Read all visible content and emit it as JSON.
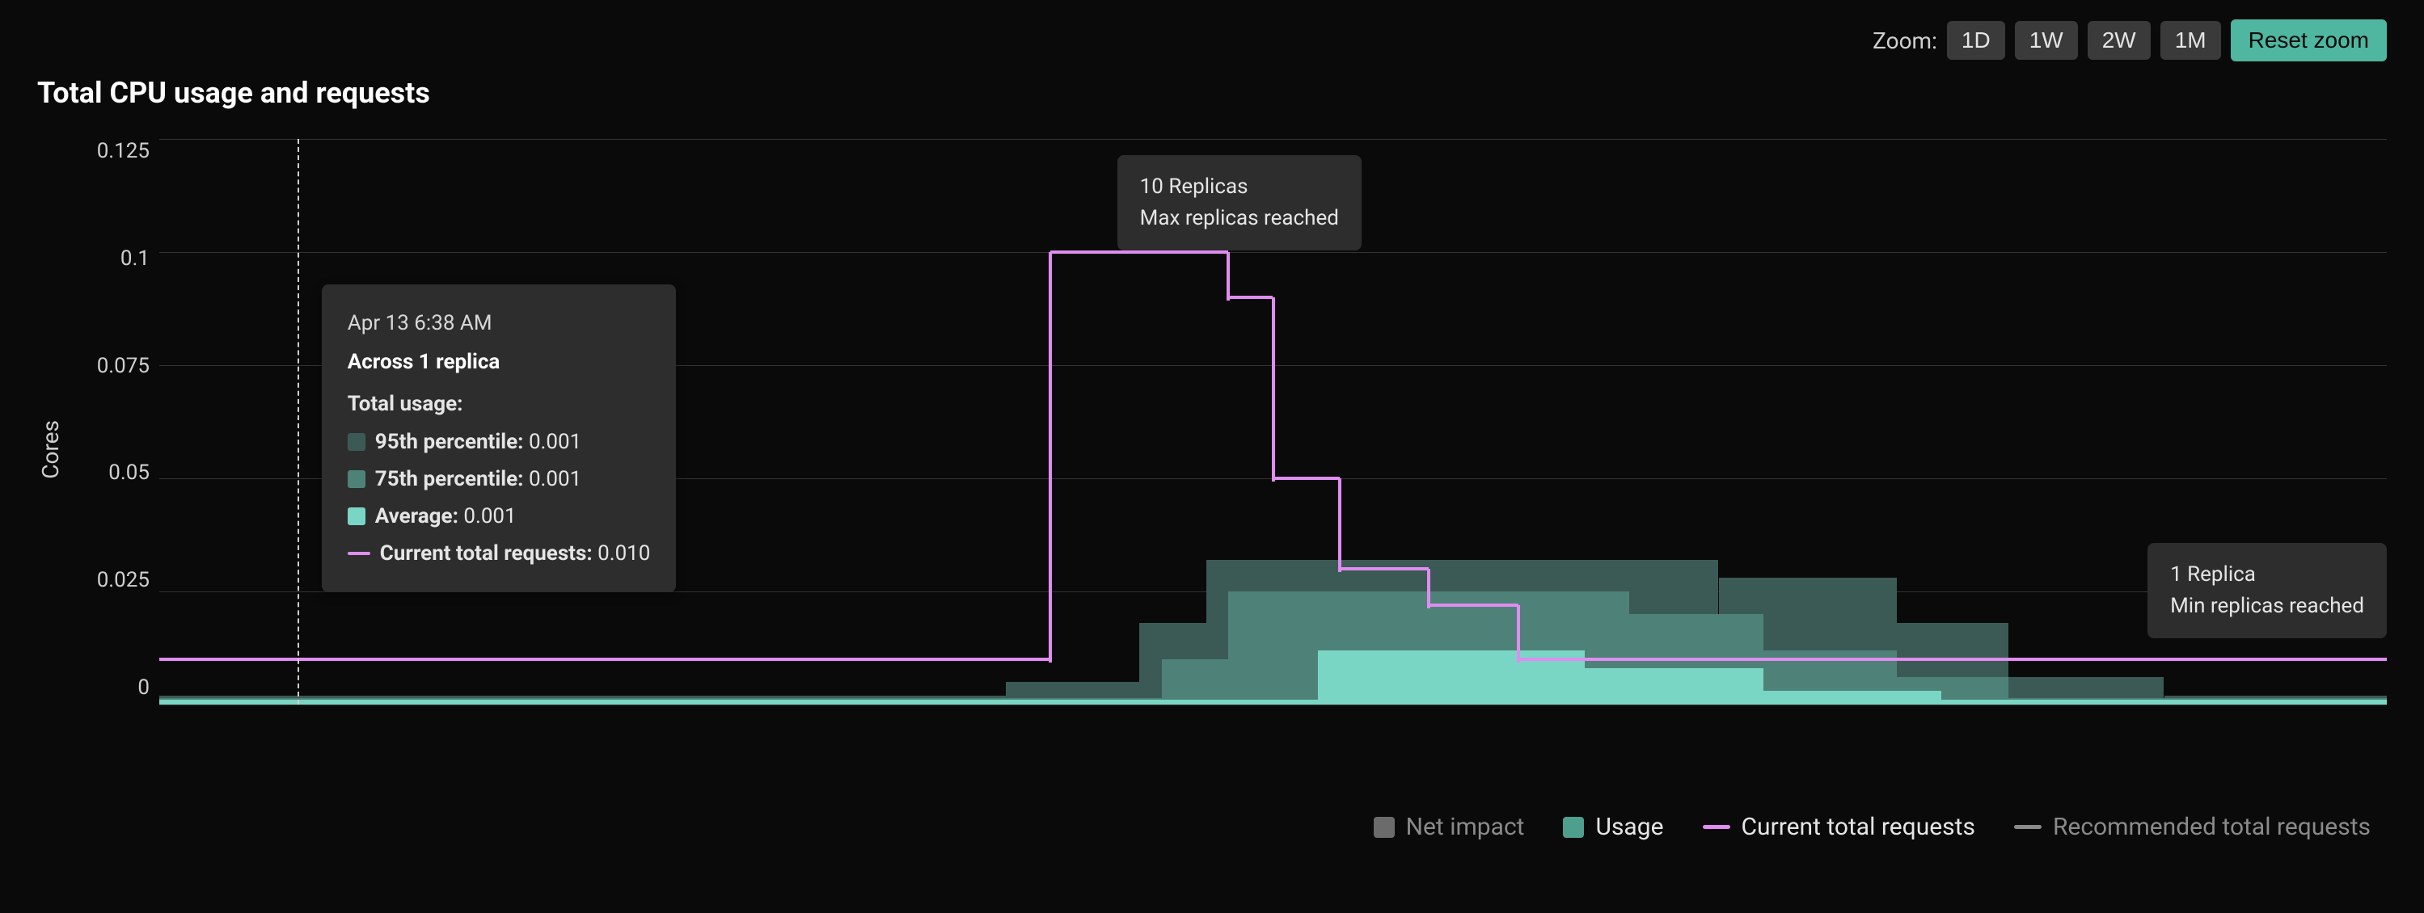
{
  "zoom": {
    "label": "Zoom:",
    "options": [
      "1D",
      "1W",
      "2W",
      "1M"
    ],
    "reset": "Reset zoom"
  },
  "title": "Total CPU usage and requests",
  "ylabel": "Cores",
  "tooltip": {
    "time": "Apr 13 6:38 AM",
    "replicas": "Across 1 replica",
    "section": "Total usage:",
    "p95_label": "95th percentile:",
    "p95_value": "0.001",
    "p75_label": "75th percentile:",
    "p75_value": "0.001",
    "avg_label": "Average:",
    "avg_value": "0.001",
    "req_label": "Current total requests:",
    "req_value": "0.010"
  },
  "callout_max": {
    "line1": "10 Replicas",
    "line2": "Max replicas reached"
  },
  "callout_min": {
    "line1": "1 Replica",
    "line2": "Min replicas reached"
  },
  "legend": {
    "net": "Net impact",
    "usage": "Usage",
    "current": "Current total requests",
    "recommended": "Recommended total requests"
  },
  "chart_data": {
    "type": "area+line",
    "ylabel": "Cores",
    "ylim": [
      0,
      0.125
    ],
    "yticks": [
      0,
      0.025,
      0.05,
      0.075,
      0.1,
      0.125
    ],
    "x_range_pct": [
      0,
      100
    ],
    "cursor_x_pct": 6.2,
    "series": [
      {
        "name": "95th percentile",
        "kind": "area",
        "color": "#3c5a55",
        "segments_pct": [
          {
            "x0": 0,
            "x1": 38,
            "y": 0.002
          },
          {
            "x0": 38,
            "x1": 44,
            "y": 0.005
          },
          {
            "x0": 44,
            "x1": 47,
            "y": 0.018
          },
          {
            "x0": 47,
            "x1": 70,
            "y": 0.032
          },
          {
            "x0": 70,
            "x1": 78,
            "y": 0.028
          },
          {
            "x0": 78,
            "x1": 83,
            "y": 0.018
          },
          {
            "x0": 83,
            "x1": 90,
            "y": 0.006
          },
          {
            "x0": 90,
            "x1": 100,
            "y": 0.002
          }
        ]
      },
      {
        "name": "75th percentile",
        "kind": "area",
        "color": "#4e8278",
        "segments_pct": [
          {
            "x0": 0,
            "x1": 45,
            "y": 0.0015
          },
          {
            "x0": 45,
            "x1": 48,
            "y": 0.01
          },
          {
            "x0": 48,
            "x1": 66,
            "y": 0.025
          },
          {
            "x0": 66,
            "x1": 72,
            "y": 0.02
          },
          {
            "x0": 72,
            "x1": 78,
            "y": 0.012
          },
          {
            "x0": 78,
            "x1": 83,
            "y": 0.006
          },
          {
            "x0": 83,
            "x1": 100,
            "y": 0.0015
          }
        ]
      },
      {
        "name": "Average",
        "kind": "area",
        "color": "#7ad6c4",
        "segments_pct": [
          {
            "x0": 0,
            "x1": 52,
            "y": 0.001
          },
          {
            "x0": 52,
            "x1": 64,
            "y": 0.012
          },
          {
            "x0": 64,
            "x1": 72,
            "y": 0.008
          },
          {
            "x0": 72,
            "x1": 80,
            "y": 0.003
          },
          {
            "x0": 80,
            "x1": 100,
            "y": 0.001
          }
        ]
      },
      {
        "name": "Current total requests",
        "kind": "step-line",
        "color": "#e08cf0",
        "points_pct": [
          {
            "x": 0,
            "y": 0.01
          },
          {
            "x": 40,
            "y": 0.01
          },
          {
            "x": 40,
            "y": 0.1
          },
          {
            "x": 48,
            "y": 0.1
          },
          {
            "x": 48,
            "y": 0.09
          },
          {
            "x": 50,
            "y": 0.09
          },
          {
            "x": 50,
            "y": 0.05
          },
          {
            "x": 53,
            "y": 0.05
          },
          {
            "x": 53,
            "y": 0.03
          },
          {
            "x": 57,
            "y": 0.03
          },
          {
            "x": 57,
            "y": 0.022
          },
          {
            "x": 61,
            "y": 0.022
          },
          {
            "x": 61,
            "y": 0.01
          },
          {
            "x": 100,
            "y": 0.01
          }
        ]
      }
    ],
    "annotations": [
      {
        "x_pct": 44,
        "text": "10 Replicas — Max replicas reached"
      },
      {
        "x_pct": 97,
        "text": "1 Replica — Min replicas reached"
      }
    ]
  }
}
